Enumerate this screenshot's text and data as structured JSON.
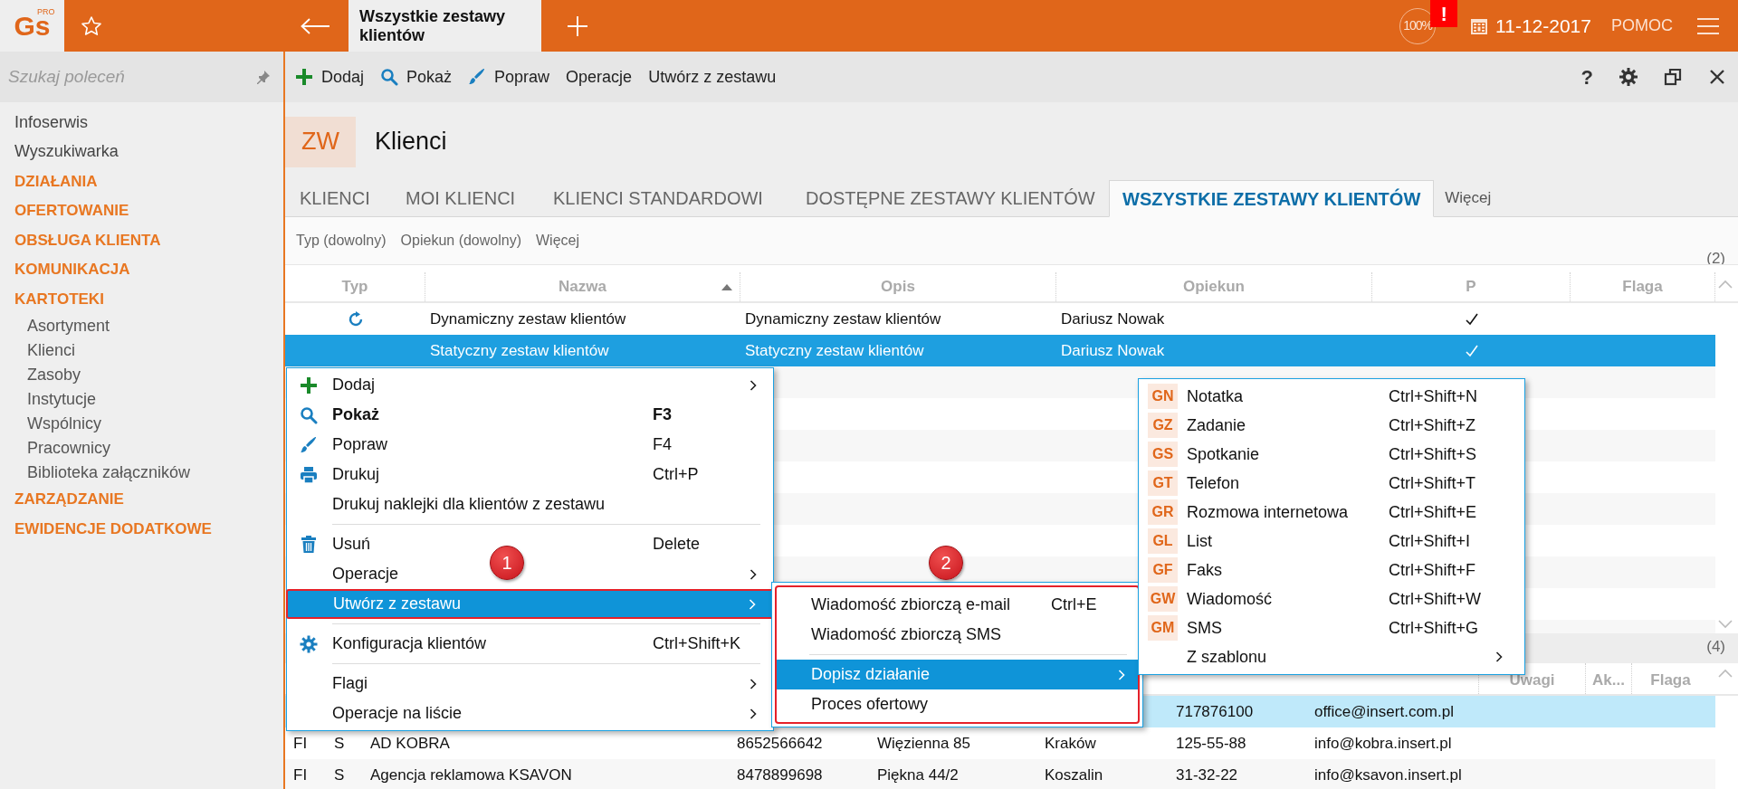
{
  "app": {
    "logo": "Gs",
    "logo_badge": "PRO",
    "tab_title": "Wszystkie zestawy klientów",
    "zoom": "100%",
    "alert": "!",
    "date": "11-12-2017",
    "help": "POMOC"
  },
  "sidebar": {
    "search": {
      "placeholder": "Szukaj poleceń"
    },
    "items": [
      {
        "kind": "link",
        "label": "Infoserwis"
      },
      {
        "kind": "link",
        "label": "Wyszukiwarka"
      },
      {
        "kind": "group",
        "label": "DZIAŁANIA"
      },
      {
        "kind": "group",
        "label": "OFERTOWANIE"
      },
      {
        "kind": "group",
        "label": "OBSŁUGA KLIENTA"
      },
      {
        "kind": "group",
        "label": "KOMUNIKACJA"
      },
      {
        "kind": "group",
        "label": "KARTOTEKI",
        "children": [
          {
            "label": "Asortyment"
          },
          {
            "label": "Klienci"
          },
          {
            "label": "Zasoby"
          },
          {
            "label": "Instytucje"
          },
          {
            "label": "Wspólnicy"
          },
          {
            "label": "Pracownicy"
          },
          {
            "label": "Biblioteka załączników"
          }
        ]
      },
      {
        "kind": "group",
        "label": "ZARZĄDZANIE"
      },
      {
        "kind": "group",
        "label": "EWIDENCJE DODATKOWE"
      }
    ]
  },
  "toolbar": {
    "buttons": [
      {
        "kind": "add",
        "label": "Dodaj"
      },
      {
        "kind": "show",
        "label": "Pokaż"
      },
      {
        "kind": "edit",
        "label": "Popraw"
      },
      {
        "kind": "plain",
        "label": "Operacje"
      },
      {
        "kind": "plain",
        "label": "Utwórz z zestawu"
      }
    ],
    "help": "?"
  },
  "header": {
    "badge": "ZW",
    "title": "Klienci"
  },
  "tabs": [
    {
      "label": "KLIENCI",
      "selected": false
    },
    {
      "label": "MOI KLIENCI",
      "selected": false
    },
    {
      "label": "KLIENCI STANDARDOWI",
      "selected": false
    },
    {
      "label": "DOSTĘPNE ZESTAWY KLIENTÓW",
      "selected": false
    },
    {
      "label": "WSZYSTKIE ZESTAWY KLIENTÓW",
      "selected": true
    },
    {
      "label": "Więcej",
      "selected": false
    }
  ],
  "filters": [
    "Typ (dowolny)",
    "Opiekun (dowolny)",
    "Więcej"
  ],
  "sets_table": {
    "count": "(2)",
    "columns": [
      {
        "label": "Typ",
        "sorted": false
      },
      {
        "label": "Nazwa",
        "sorted": true
      },
      {
        "label": "Opis",
        "sorted": false
      },
      {
        "label": "Opiekun",
        "sorted": false
      },
      {
        "label": "P",
        "sorted": false
      },
      {
        "label": "Flaga",
        "sorted": false
      }
    ],
    "rows": [
      {
        "kind": "dynamic",
        "name": "Dynamiczny zestaw klientów",
        "description": "Dynamiczny zestaw klientów",
        "owner": "Dariusz Nowak",
        "p_checked": true,
        "selected": false
      },
      {
        "kind": "static",
        "name": "Statyczny zestaw klientów",
        "description": "Statyczny zestaw klientów",
        "owner": "Dariusz Nowak",
        "p_checked": true,
        "selected": true
      }
    ]
  },
  "clients_table": {
    "count": "(4)",
    "columns": [
      "Uwagi",
      "Ak...",
      "Flaga"
    ],
    "rows": [
      {
        "phone": "717876100",
        "email": "office@insert.com.pl",
        "selected": true
      },
      {
        "type": "FI",
        "status": "S",
        "name": "AD KOBRA",
        "nip": "8652566642",
        "street": "Więzienna 85",
        "city": "Kraków",
        "phone": "125-55-88",
        "email": "info@kobra.insert.pl",
        "selected": false
      },
      {
        "type": "FI",
        "status": "S",
        "name": "Agencja reklamowa KSAVON",
        "nip": "8478899698",
        "street": "Piękna  44/2",
        "city": "Koszalin",
        "phone": "31-32-22",
        "email": "info@ksavon.insert.pl",
        "selected": false
      }
    ]
  },
  "context_menu": {
    "items": [
      {
        "kind": "add",
        "label": "Dodaj",
        "has_submenu": true,
        "default": false,
        "selected": false,
        "outlined": false
      },
      {
        "kind": "show",
        "label": "Pokaż",
        "shortcut": "F3",
        "has_submenu": false,
        "default": true,
        "selected": false,
        "outlined": false
      },
      {
        "kind": "edit",
        "label": "Popraw",
        "shortcut": "F4",
        "has_submenu": false,
        "default": false,
        "selected": false,
        "outlined": false
      },
      {
        "kind": "print",
        "label": "Drukuj",
        "shortcut": "Ctrl+P",
        "has_submenu": false,
        "default": false,
        "selected": false,
        "outlined": false
      },
      {
        "kind": "plain",
        "label": "Drukuj naklejki dla klientów z zestawu",
        "has_submenu": false,
        "default": false,
        "selected": false,
        "outlined": false
      },
      {
        "kind": "separator"
      },
      {
        "kind": "delete",
        "label": "Usuń",
        "shortcut": "Delete",
        "has_submenu": false,
        "default": false,
        "selected": false,
        "outlined": false
      },
      {
        "kind": "plain",
        "label": "Operacje",
        "has_submenu": true,
        "default": false,
        "selected": false,
        "outlined": false
      },
      {
        "kind": "plain",
        "label": "Utwórz z zestawu",
        "has_submenu": true,
        "default": false,
        "selected": true,
        "outlined": true
      },
      {
        "kind": "separator"
      },
      {
        "kind": "settings",
        "label": "Konfiguracja klientów",
        "shortcut": "Ctrl+Shift+K",
        "has_submenu": false,
        "default": false,
        "selected": false,
        "outlined": false
      },
      {
        "kind": "separator"
      },
      {
        "kind": "plain",
        "label": "Flagi",
        "has_submenu": true,
        "default": false,
        "selected": false,
        "outlined": false
      },
      {
        "kind": "plain",
        "label": "Operacje na liście",
        "has_submenu": true,
        "default": false,
        "selected": false,
        "outlined": false
      }
    ]
  },
  "create_submenu": {
    "outlined": true,
    "items": [
      {
        "kind": "item",
        "label": "Wiadomość zbiorczą e-mail",
        "shortcut": "Ctrl+E",
        "has_submenu": false,
        "selected": false
      },
      {
        "kind": "item",
        "label": "Wiadomość zbiorczą SMS",
        "has_submenu": false,
        "selected": false
      },
      {
        "kind": "separator"
      },
      {
        "kind": "item",
        "label": "Dopisz działanie",
        "has_submenu": true,
        "selected": true
      },
      {
        "kind": "item",
        "label": "Proces ofertowy",
        "has_submenu": false,
        "selected": false
      }
    ]
  },
  "activity_submenu": {
    "items": [
      {
        "code": "GN",
        "label": "Notatka",
        "shortcut": "Ctrl+Shift+N",
        "has_submenu": false
      },
      {
        "code": "GZ",
        "label": "Zadanie",
        "shortcut": "Ctrl+Shift+Z",
        "has_submenu": false
      },
      {
        "code": "GS",
        "label": "Spotkanie",
        "shortcut": "Ctrl+Shift+S",
        "has_submenu": false
      },
      {
        "code": "GT",
        "label": "Telefon",
        "shortcut": "Ctrl+Shift+T",
        "has_submenu": false
      },
      {
        "code": "GR",
        "label": "Rozmowa internetowa",
        "shortcut": "Ctrl+Shift+E",
        "has_submenu": false
      },
      {
        "code": "GL",
        "label": "List",
        "shortcut": "Ctrl+Shift+I",
        "has_submenu": false
      },
      {
        "code": "GF",
        "label": "Faks",
        "shortcut": "Ctrl+Shift+F",
        "has_submenu": false
      },
      {
        "code": "GW",
        "label": "Wiadomość",
        "shortcut": "Ctrl+Shift+W",
        "has_submenu": false
      },
      {
        "code": "GM",
        "label": "SMS",
        "shortcut": "Ctrl+Shift+G",
        "has_submenu": false
      },
      {
        "label": "Z szablonu",
        "has_submenu": true
      }
    ]
  },
  "markers": [
    "1",
    "2"
  ]
}
